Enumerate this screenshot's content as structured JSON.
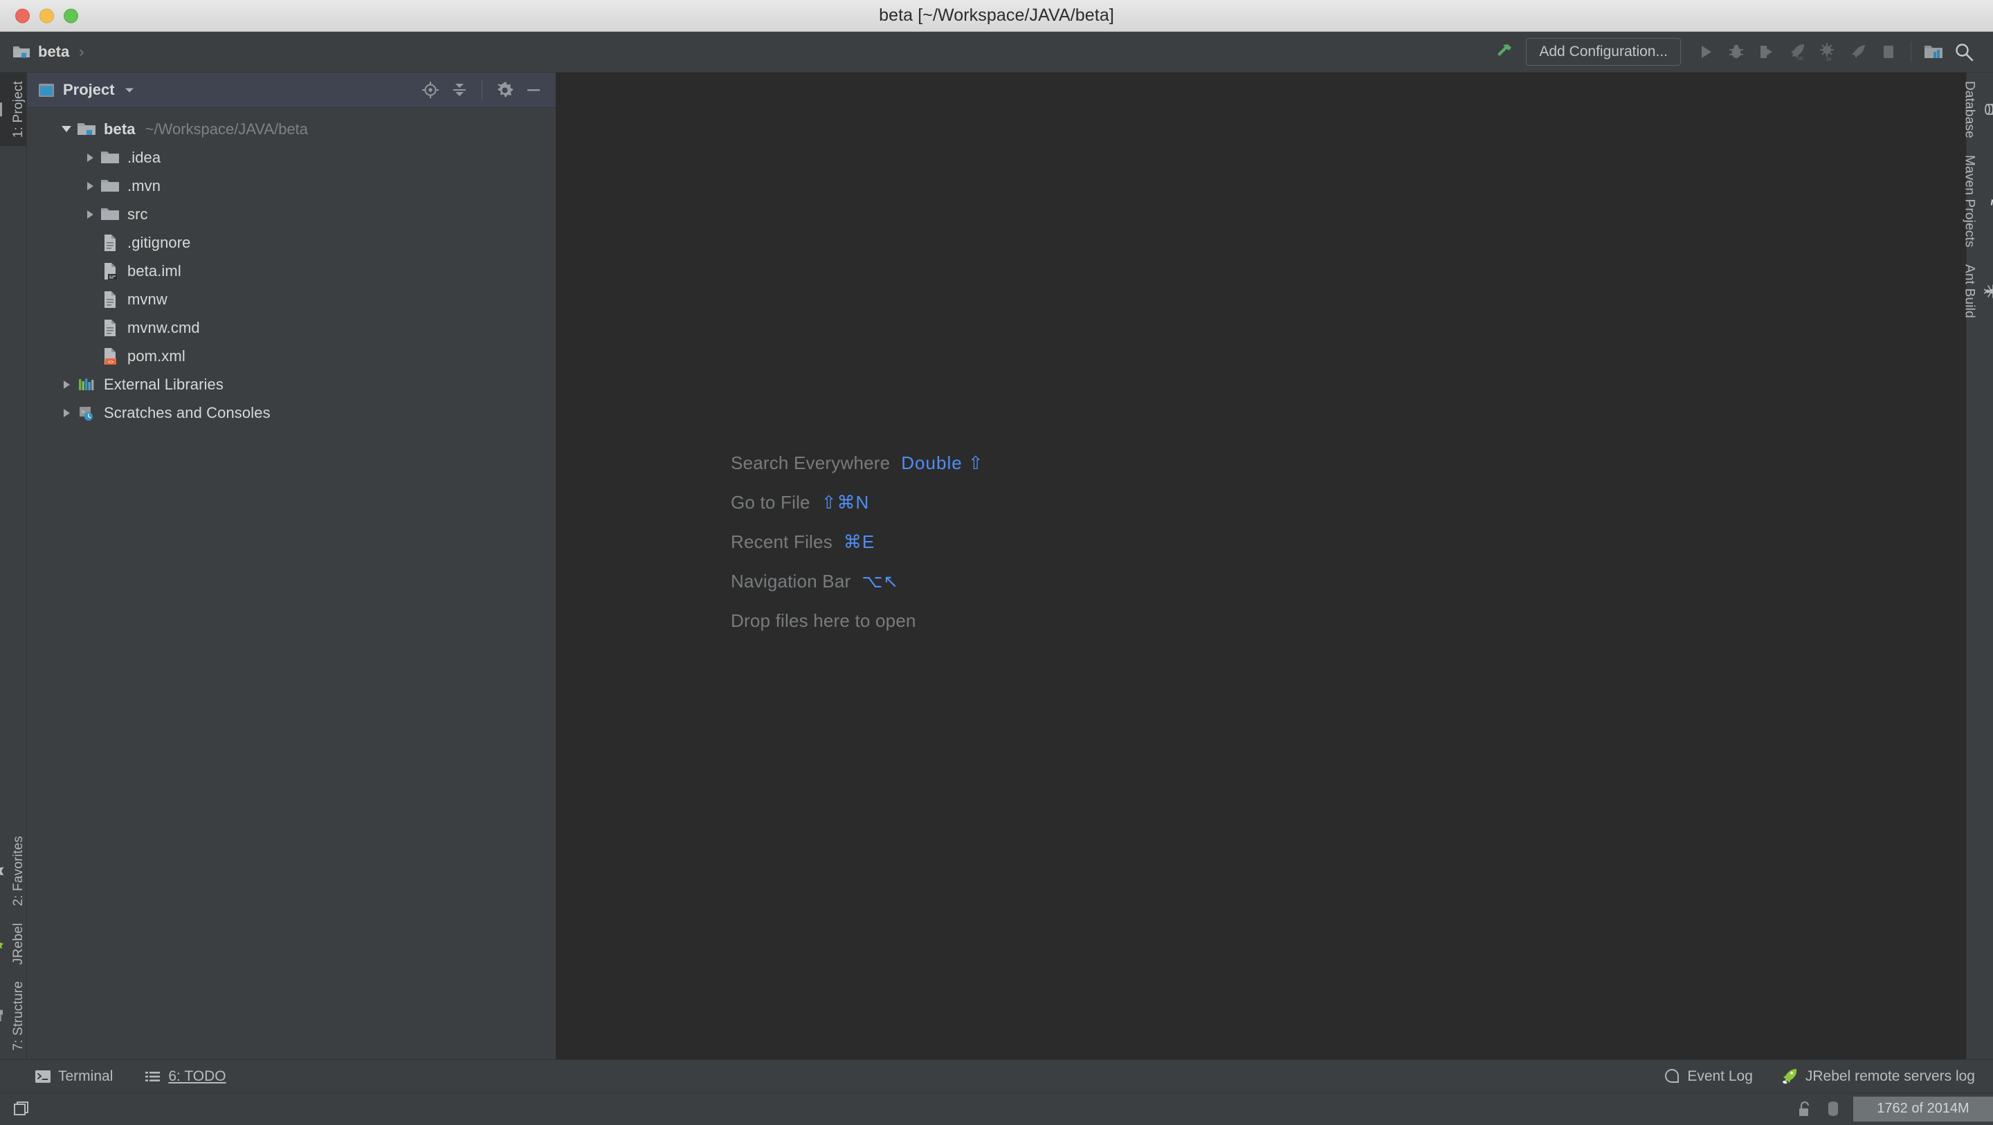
{
  "window": {
    "title": "beta [~/Workspace/JAVA/beta]",
    "traffic_lights": [
      "close-red",
      "minimize-yellow",
      "zoom-green"
    ],
    "colors": {
      "titlebar_bg": "#e0e0e0",
      "chrome_bg": "#3c3f41",
      "editor_bg": "#2b2b2b",
      "toolwindow_header_bg": "#3f4450",
      "accent_blue": "#4f8ef7",
      "text_primary": "#d8d8d8",
      "text_muted": "#787c7e"
    }
  },
  "navbar": {
    "breadcrumbs": [
      {
        "label": "beta",
        "icon": "project-folder-icon"
      }
    ],
    "separator": "›",
    "build_icon": "hammer-icon",
    "add_configuration": "Add Configuration...",
    "run_icons": [
      {
        "name": "run-icon",
        "tooltip": "Run"
      },
      {
        "name": "debug-icon",
        "tooltip": "Debug"
      },
      {
        "name": "run-with-coverage-icon",
        "tooltip": "Run with Coverage"
      },
      {
        "name": "jrebel-run-icon",
        "tooltip": "Run with JRebel"
      },
      {
        "name": "jrebel-debug-icon",
        "tooltip": "Debug with JRebel"
      },
      {
        "name": "jrebel-profile-icon",
        "tooltip": "Profile with JRebel"
      },
      {
        "name": "stop-icon",
        "tooltip": "Stop"
      }
    ],
    "right_icons": [
      {
        "name": "search-everywhere-project-icon"
      },
      {
        "name": "search-icon"
      }
    ]
  },
  "left_strip": {
    "tabs": [
      {
        "label": "1: Project",
        "icon": "project-folder-icon",
        "active": true
      },
      {
        "label": "2: Favorites",
        "icon": "star-icon",
        "active": false
      },
      {
        "label": "JRebel",
        "icon": "jrebel-rocket-icon",
        "active": false
      },
      {
        "label": "7: Structure",
        "icon": "structure-icon",
        "active": false
      }
    ]
  },
  "right_strip": {
    "tabs": [
      {
        "label": "Database",
        "icon": "database-icon"
      },
      {
        "label": "Maven Projects",
        "icon": "maven-m-icon"
      },
      {
        "label": "Ant Build",
        "icon": "ant-icon"
      }
    ]
  },
  "project_panel": {
    "title": "Project",
    "title_icon": "project-view-icon",
    "dropdown_icon": "chevron-down-icon",
    "actions": [
      {
        "name": "locate-icon",
        "tooltip": "Select Opened File"
      },
      {
        "name": "collapse-all-icon",
        "tooltip": "Collapse All"
      },
      {
        "name": "gear-icon",
        "tooltip": "Settings"
      },
      {
        "name": "hide-icon",
        "tooltip": "Hide"
      }
    ],
    "tree": [
      {
        "label": "beta",
        "path": "~/Workspace/JAVA/beta",
        "icon": "project-folder-icon",
        "indent": 0,
        "arrow": "open",
        "bold": true
      },
      {
        "label": ".idea",
        "path": "",
        "icon": "folder-icon",
        "indent": 1,
        "arrow": "closed",
        "bold": false
      },
      {
        "label": ".mvn",
        "path": "",
        "icon": "folder-icon",
        "indent": 1,
        "arrow": "closed",
        "bold": false
      },
      {
        "label": "src",
        "path": "",
        "icon": "folder-icon",
        "indent": 1,
        "arrow": "closed",
        "bold": false
      },
      {
        "label": ".gitignore",
        "path": "",
        "icon": "file-icon",
        "indent": 1,
        "arrow": "none",
        "bold": false
      },
      {
        "label": "beta.iml",
        "path": "",
        "icon": "iml-file-icon",
        "indent": 1,
        "arrow": "none",
        "bold": false
      },
      {
        "label": "mvnw",
        "path": "",
        "icon": "file-icon",
        "indent": 1,
        "arrow": "none",
        "bold": false
      },
      {
        "label": "mvnw.cmd",
        "path": "",
        "icon": "file-icon",
        "indent": 1,
        "arrow": "none",
        "bold": false
      },
      {
        "label": "pom.xml",
        "path": "",
        "icon": "xml-file-icon",
        "indent": 1,
        "arrow": "none",
        "bold": false
      },
      {
        "label": "External Libraries",
        "path": "",
        "icon": "libraries-icon",
        "indent": 0,
        "arrow": "closed",
        "bold": false
      },
      {
        "label": "Scratches and Consoles",
        "path": "",
        "icon": "scratches-icon",
        "indent": 0,
        "arrow": "closed",
        "bold": false
      }
    ]
  },
  "editor": {
    "hints": [
      {
        "action": "Search Everywhere",
        "shortcut": "Double ⇧"
      },
      {
        "action": "Go to File",
        "shortcut": "⇧⌘N"
      },
      {
        "action": "Recent Files",
        "shortcut": "⌘E"
      },
      {
        "action": "Navigation Bar",
        "shortcut": "⌥↖"
      }
    ],
    "drop_hint": "Drop files here to open"
  },
  "bottom_bar": {
    "left_tabs": [
      {
        "label": "Terminal",
        "icon": "terminal-icon"
      },
      {
        "label": "6: TODO",
        "icon": "todo-list-icon",
        "mnemonic": "6"
      }
    ],
    "right_tabs": [
      {
        "label": "Event Log",
        "icon": "event-log-icon"
      },
      {
        "label": "JRebel remote servers log",
        "icon": "jrebel-rocket-icon"
      }
    ]
  },
  "status_bar": {
    "left_icon": "toggle-toolwindows-icon",
    "lock_icon": "unlocked-icon",
    "db_icon": "database-status-icon",
    "memory": "1762 of 2014M"
  }
}
